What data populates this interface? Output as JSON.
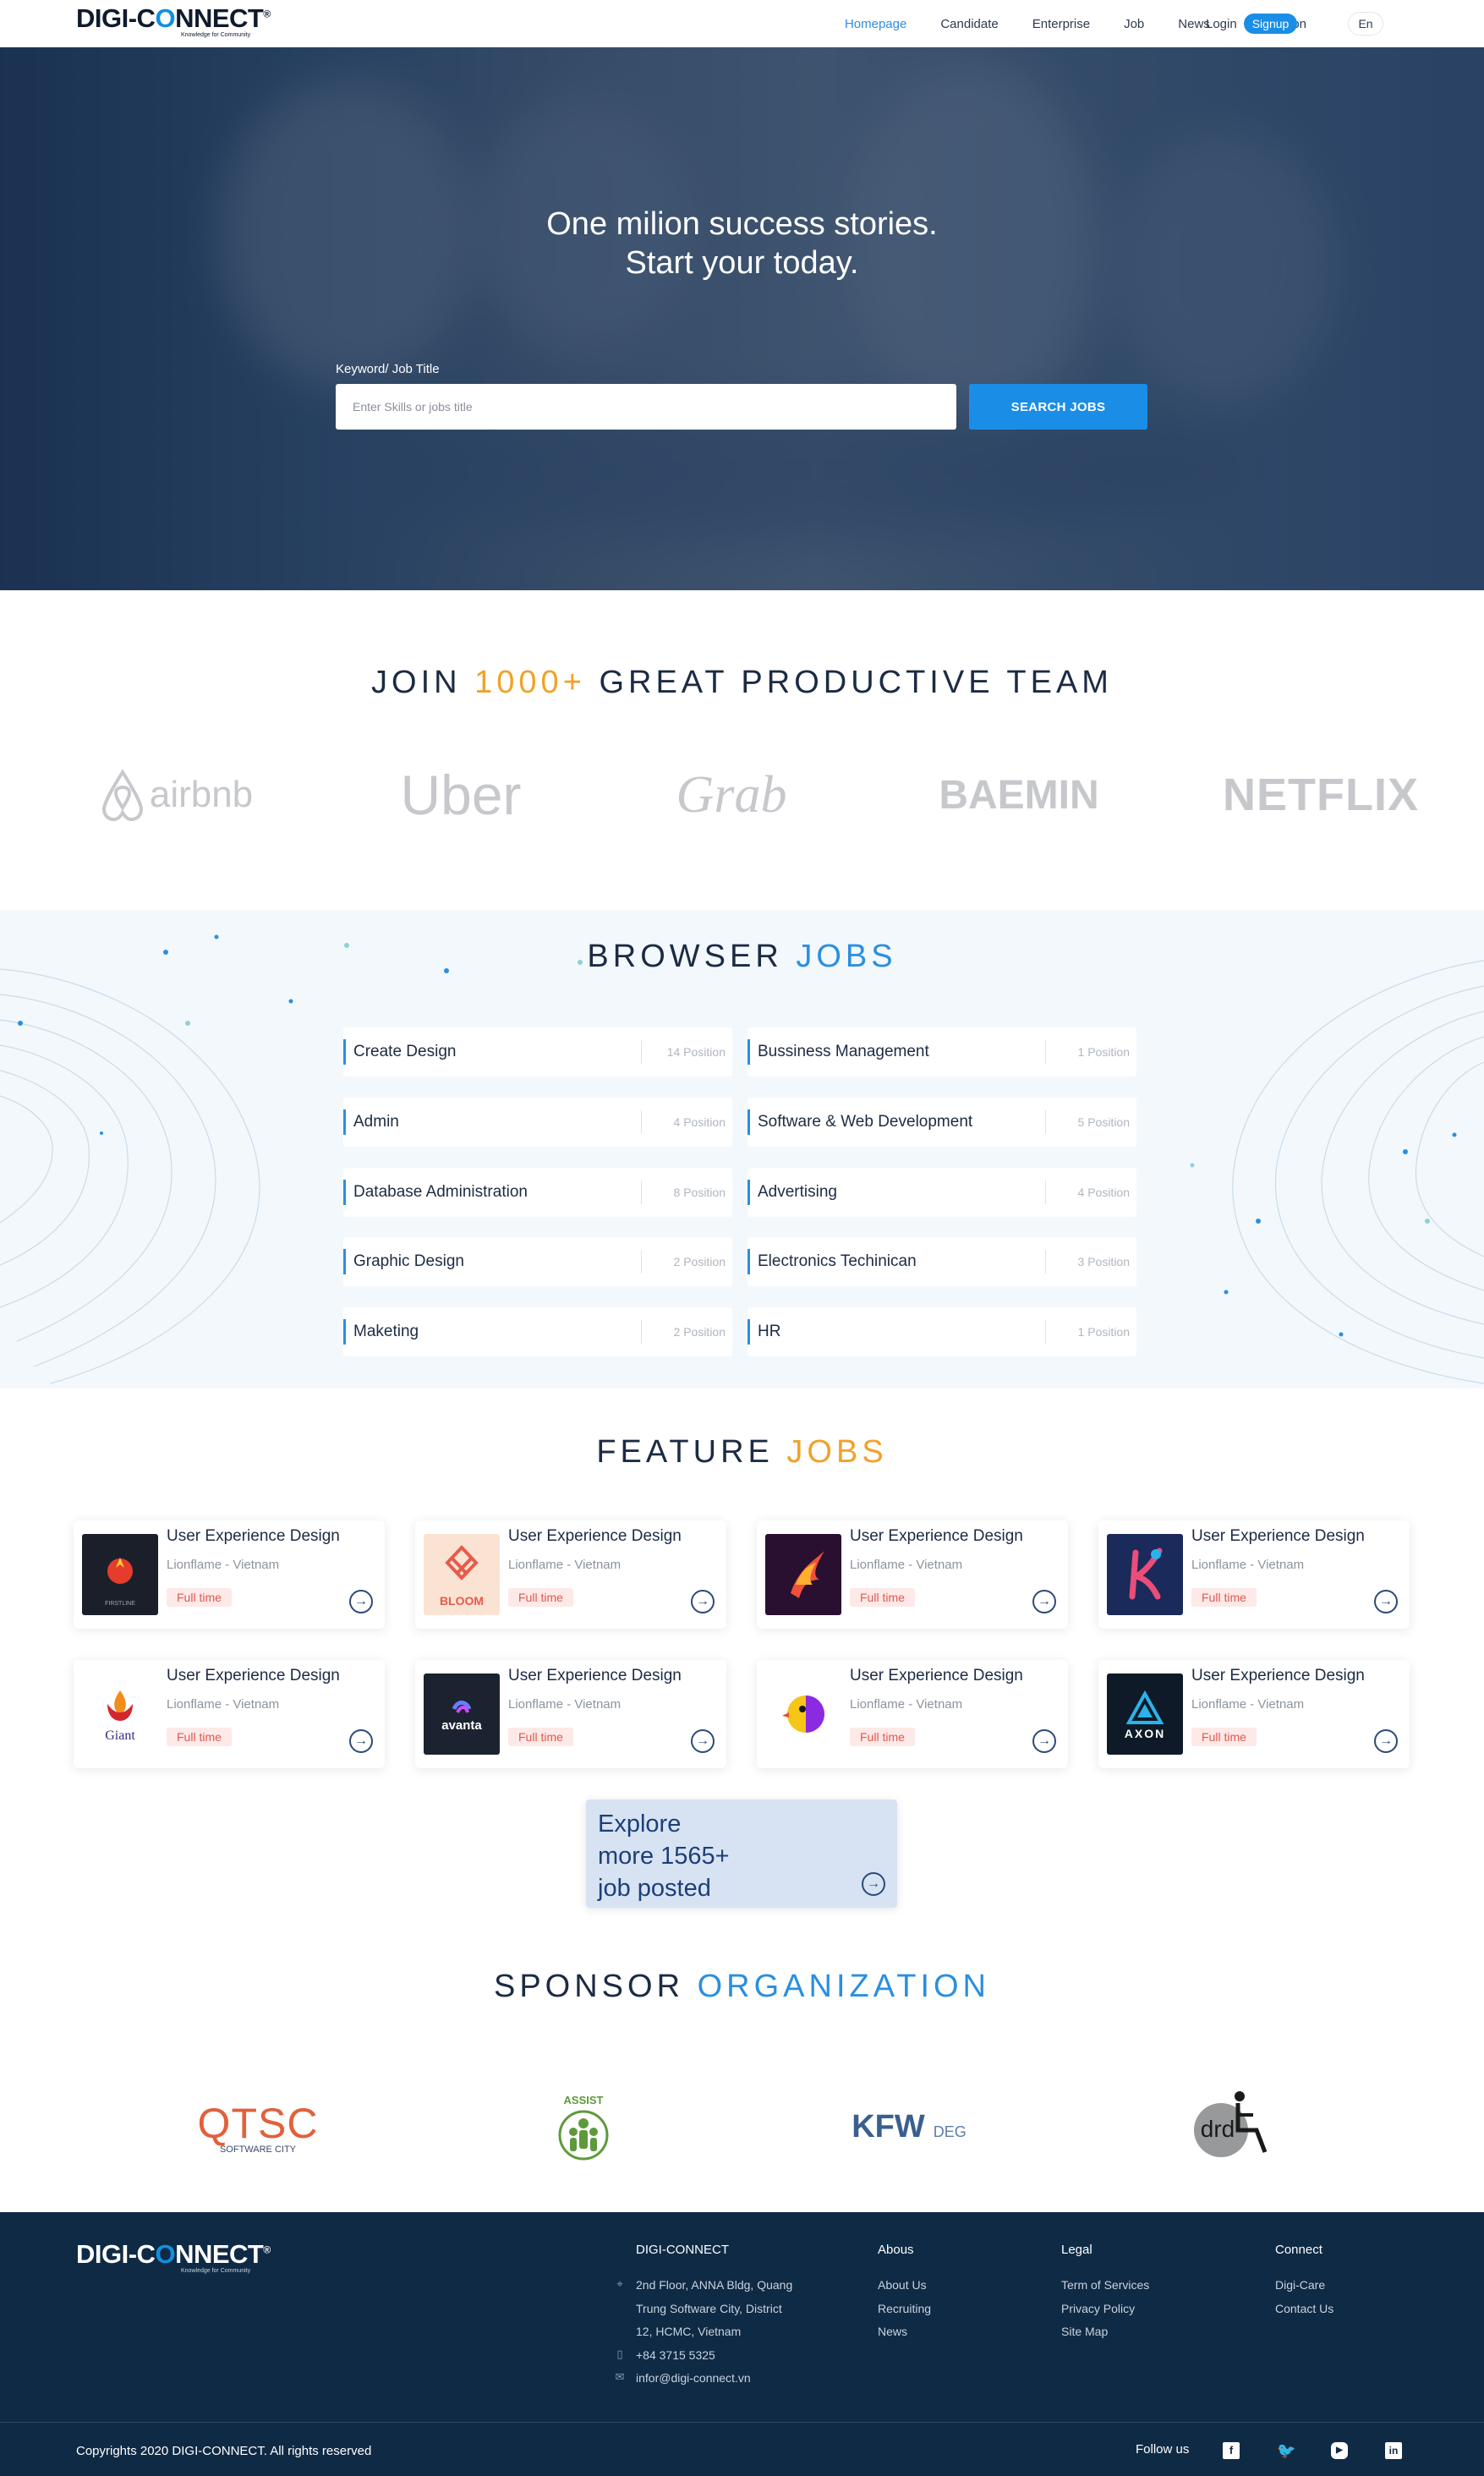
{
  "nav": {
    "logo": {
      "prefix": "DIGI-C",
      "o": "O",
      "suffix": "NNECT",
      "mark": "®",
      "tagline": "Knowledge for Community"
    },
    "links": [
      "Homepage",
      "Candidate",
      "Enterprise",
      "Job",
      "News",
      "Notification"
    ],
    "active": "Homepage",
    "login": "Login",
    "signup": "Signup",
    "language": "En"
  },
  "hero": {
    "title_line1": "One milion success stories.",
    "title_line2": "Start your today.",
    "search_label": "Keyword/ Job Title",
    "search_placeholder": "Enter Skills or jobs title",
    "search_button": "SEARCH JOBS"
  },
  "partners": {
    "title_pre": "JOIN ",
    "title_highlight": "1000+",
    "title_post": " GREAT PRODUCTIVE TEAM",
    "logos": [
      "airbnb",
      "Uber",
      "Grab",
      "BAEMIN",
      "NETFLIX"
    ]
  },
  "browse": {
    "title_pre": "BROWSER ",
    "title_highlight": "JOBS",
    "categories": [
      {
        "name": "Create Design",
        "count": "14 Position"
      },
      {
        "name": "Bussiness Management",
        "count": "1 Position"
      },
      {
        "name": "Admin",
        "count": "4 Position"
      },
      {
        "name": "Software & Web Development",
        "count": "5 Position"
      },
      {
        "name": "Database Administration",
        "count": "8 Position"
      },
      {
        "name": "Advertising",
        "count": "4 Position"
      },
      {
        "name": "Graphic Design",
        "count": "2 Position"
      },
      {
        "name": "Electronics Techinican",
        "count": "3 Position"
      },
      {
        "name": "Maketing",
        "count": "2 Position"
      },
      {
        "name": "HR",
        "count": "1 Position"
      }
    ]
  },
  "feature": {
    "title_pre": "FEATURE ",
    "title_highlight": "JOBS",
    "jobs": [
      {
        "title": "User Experience Design",
        "company": "Lionflame - Vietnam",
        "type": "Full time",
        "logo": "firstline-logo"
      },
      {
        "title": "User Experience Design",
        "company": "Lionflame - Vietnam",
        "type": "Full time",
        "logo": "bloom-logo"
      },
      {
        "title": "User Experience Design",
        "company": "Lionflame - Vietnam",
        "type": "Full time",
        "logo": "phoenix-logo"
      },
      {
        "title": "User Experience Design",
        "company": "Lionflame - Vietnam",
        "type": "Full time",
        "logo": "k-runner-logo"
      },
      {
        "title": "User Experience Design",
        "company": "Lionflame - Vietnam",
        "type": "Full time",
        "logo": "giant-logo"
      },
      {
        "title": "User Experience Design",
        "company": "Lionflame - Vietnam",
        "type": "Full time",
        "logo": "avanta-logo"
      },
      {
        "title": "User Experience Design",
        "company": "Lionflame - Vietnam",
        "type": "Full time",
        "logo": "bird-logo"
      },
      {
        "title": "User Experience Design",
        "company": "Lionflame - Vietnam",
        "type": "Full time",
        "logo": "axon-logo"
      }
    ],
    "logo_text": {
      "firstline": "FIRSTLINE",
      "bloom": "BLOOM",
      "giant": "Giant",
      "avanta": "avanta",
      "axon": "AXON"
    },
    "explore_line1": "Explore",
    "explore_line2": "more 1565+",
    "explore_line3": "job posted"
  },
  "sponsors": {
    "title_pre": "SPONSOR ",
    "title_highlight": "ORGANIZATION",
    "logos": [
      {
        "main": "QTSC",
        "sub": "SOFTWARE CITY"
      },
      {
        "main": "ASSIST"
      },
      {
        "main": "KFW",
        "sub": "DEG"
      },
      {
        "main": "drd"
      }
    ]
  },
  "footer": {
    "col1_title": "DIGI-CONNECT",
    "address_line1": "2nd Floor, ANNA Bldg, Quang",
    "address_line2": "Trung Software City, District",
    "address_line3": "12, HCMC, Vietnam",
    "phone": "+84 3715 5325",
    "email": "infor@digi-connect.vn",
    "col2_title": "Abous",
    "col2_items": [
      "About Us",
      "Recruiting",
      "News"
    ],
    "col3_title": "Legal",
    "col3_items": [
      "Term of Services",
      "Privacy Policy",
      "Site Map"
    ],
    "col4_title": "Connect",
    "col4_items": [
      "Digi-Care",
      "Contact Us"
    ],
    "copyright": "Copyrights 2020 DIGI-CONNECT. All rights reserved",
    "follow_us": "Follow us",
    "social": [
      "facebook-icon",
      "twitter-icon",
      "youtube-icon",
      "linkedin-icon"
    ]
  },
  "colors": {
    "primary": "#1a8ee6",
    "accent_orange": "#f0a22b",
    "footer_bg": "#0f2a45",
    "hero_overlay": "#1f3a5c"
  }
}
